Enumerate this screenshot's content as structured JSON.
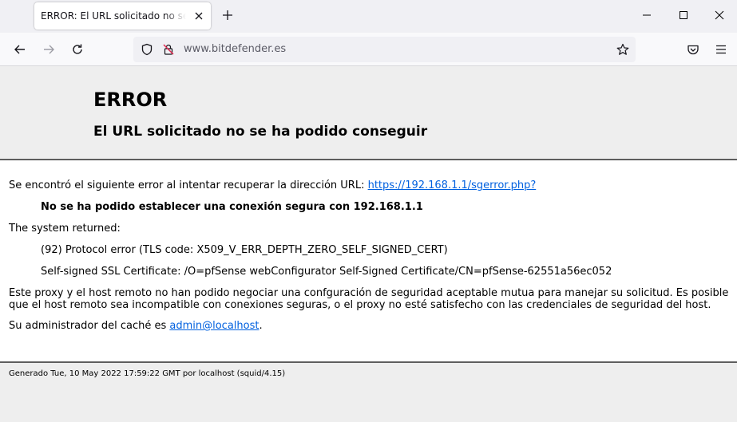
{
  "tab": {
    "title": "ERROR: El URL solicitado no se ha podido conseguir"
  },
  "address_bar": {
    "url": "www.bitdefender.es"
  },
  "icons": {
    "back": "arrow-left-icon",
    "forward": "arrow-right-icon",
    "reload": "reload-icon",
    "site_info": "shield-icon",
    "permissions": "insecure-lock-icon",
    "bookmark": "star-icon",
    "pocket": "pocket-icon",
    "menu": "hamburger-menu-icon",
    "close_tab": "close-icon",
    "new_tab": "plus-icon"
  },
  "page": {
    "title": "ERROR",
    "subtitle": "El URL solicitado no se ha podido conseguir",
    "intro_text": "Se encontró el siguiente error al intentar recuperar la dirección URL: ",
    "requested_url": "https://192.168.1.1/sgerror.php?",
    "error_message": "No se ha podido establecer una conexión segura con 192.168.1.1",
    "system_returned_label": "The system returned:",
    "system_error": "(92) Protocol error (TLS code: X509_V_ERR_DEPTH_ZERO_SELF_SIGNED_CERT)",
    "certificate_info": "Self-signed SSL Certificate: /O=pfSense webConfigurator Self-Signed Certificate/CN=pfSense-62551a56ec052",
    "explanation": "Este proxy y el host remoto no han podido negociar una confguración de seguridad aceptable mutua para manejar su solicitud. Es posible que el host remoto sea incompatible con conexiones seguras, o el proxy no esté satisfecho con las credenciales de seguridad del host.",
    "admin_text": "Su administrador del caché es ",
    "admin_email": "admin@localhost",
    "admin_suffix": ".",
    "footer": "Generado Tue, 10 May 2022 17:59:22 GMT por localhost (squid/4.15)"
  },
  "colors": {
    "link": "#0060df",
    "header_bg": "#eeeeee",
    "rule": "#5e5e5e"
  }
}
